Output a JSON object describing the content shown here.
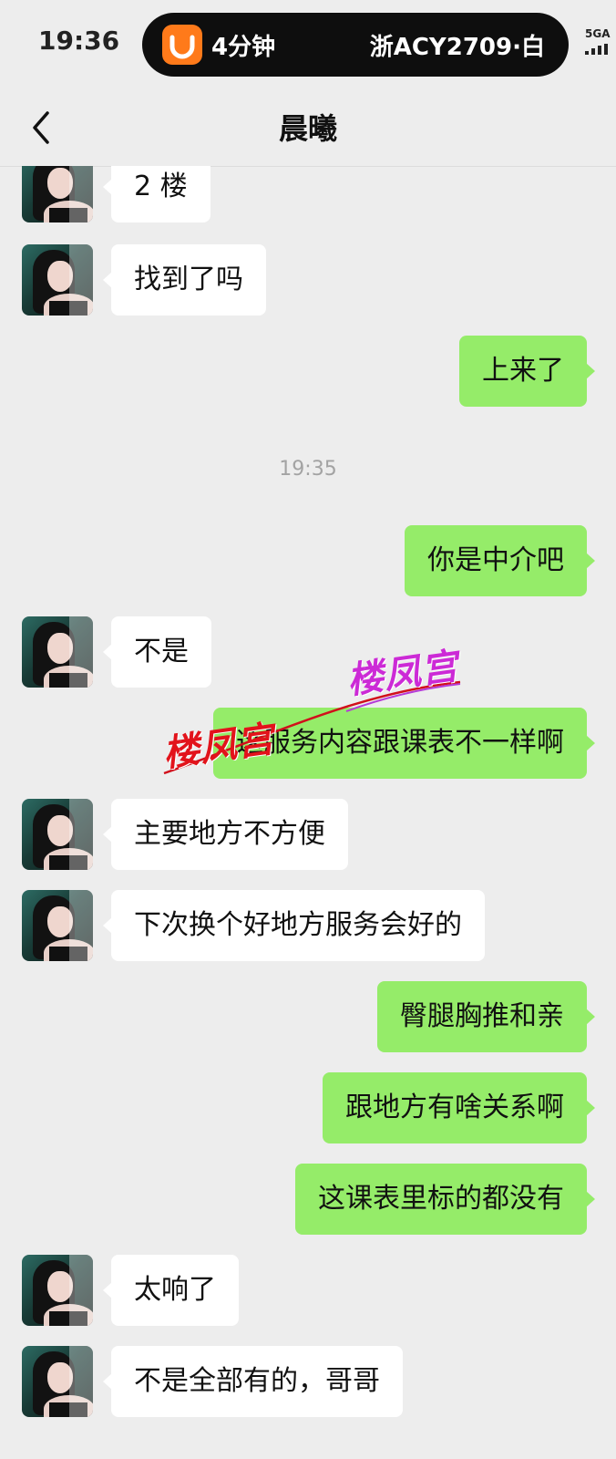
{
  "status_bar": {
    "time": "19:36",
    "island": {
      "eta": "4分钟",
      "plate": "浙ACY2709·白",
      "app_icon": "didi-app-icon"
    },
    "network": "5GA"
  },
  "header": {
    "title": "晨曦",
    "back_icon": "chevron-left-icon"
  },
  "messages": [
    {
      "side": "in",
      "text": "2 楼"
    },
    {
      "side": "in",
      "text": "找到了吗"
    },
    {
      "side": "out",
      "text": "上来了"
    },
    {
      "side": "out",
      "text": "你是中介吧"
    },
    {
      "side": "in",
      "text": "不是"
    },
    {
      "side": "out",
      "text": "这服务内容跟课表不一样啊"
    },
    {
      "side": "in",
      "text": "主要地方不方便"
    },
    {
      "side": "in",
      "text": "下次换个好地方服务会好的"
    },
    {
      "side": "out",
      "text": "臀腿胸推和亲"
    },
    {
      "side": "out",
      "text": "跟地方有啥关系啊"
    },
    {
      "side": "out",
      "text": "这课表里标的都没有"
    },
    {
      "side": "in",
      "text": "太响了"
    },
    {
      "side": "in",
      "text": "不是全部有的，哥哥"
    }
  ],
  "timestamp": "19:35",
  "watermarks": [
    {
      "text": "楼凤宫",
      "color": "#cc2ad6"
    },
    {
      "text": "楼凤宫",
      "color": "#e2131b"
    }
  ],
  "colors": {
    "incoming_bubble": "#ffffff",
    "outgoing_bubble": "#95ec69",
    "background": "#ededed"
  }
}
